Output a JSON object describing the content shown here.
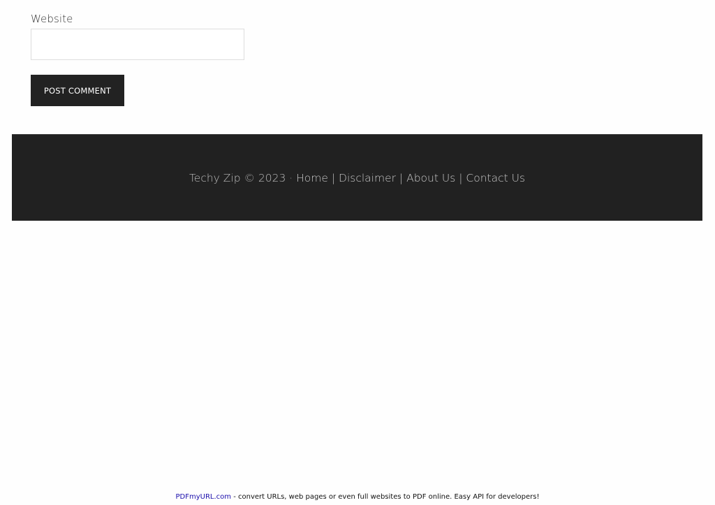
{
  "comment_form": {
    "website_label": "Website",
    "website_value": "",
    "website_placeholder": "",
    "submit_label": "POST COMMENT"
  },
  "footer": {
    "copyright": "Techy Zip © 2023 ·",
    "links": {
      "home": "Home",
      "disclaimer": "Disclaimer",
      "about": "About Us",
      "contact": "Contact Us"
    },
    "separator": "|"
  },
  "pdf_banner": {
    "link_text": "PDFmyURL.com",
    "text": " - convert URLs, web pages or even full websites to PDF online. Easy API for developers!"
  }
}
